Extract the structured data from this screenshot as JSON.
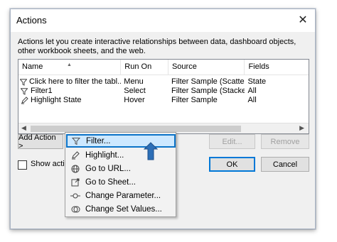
{
  "dialog": {
    "title": "Actions",
    "close_glyph": "✕",
    "description": "Actions let you create interactive relationships between data, dashboard objects, other workbook sheets, and the web."
  },
  "table": {
    "columns": [
      "Name",
      "Run On",
      "Source",
      "Fields"
    ],
    "rows": [
      {
        "icon": "filter-icon",
        "name": "Click here to filter the tabl...",
        "run_on": "Menu",
        "source": "Filter Sample (Scatter...",
        "fields": "State"
      },
      {
        "icon": "filter-icon",
        "name": "Filter1",
        "run_on": "Select",
        "source": "Filter Sample (Stacke...",
        "fields": "All"
      },
      {
        "icon": "highlighter-icon",
        "name": "Highlight State",
        "run_on": "Hover",
        "source": "Filter Sample",
        "fields": "All"
      }
    ]
  },
  "buttons": {
    "add_action": "Add Action >",
    "edit": "Edit...",
    "remove": "Remove",
    "ok": "OK",
    "cancel": "Cancel"
  },
  "show_actions_label": "Show action",
  "menu": {
    "items": [
      {
        "icon": "filter-icon",
        "label": "Filter...",
        "highlighted": true
      },
      {
        "icon": "highlighter-icon",
        "label": "Highlight..."
      },
      {
        "icon": "globe-icon",
        "label": "Go to URL..."
      },
      {
        "icon": "go-to-sheet-icon",
        "label": "Go to Sheet..."
      },
      {
        "icon": "parameter-icon",
        "label": "Change Parameter..."
      },
      {
        "icon": "set-values-icon",
        "label": "Change Set Values..."
      }
    ]
  },
  "colors": {
    "highlight_fill": "#cde8ff",
    "highlight_border": "#0b73c8",
    "callout_arrow": "#2d6fb7"
  }
}
